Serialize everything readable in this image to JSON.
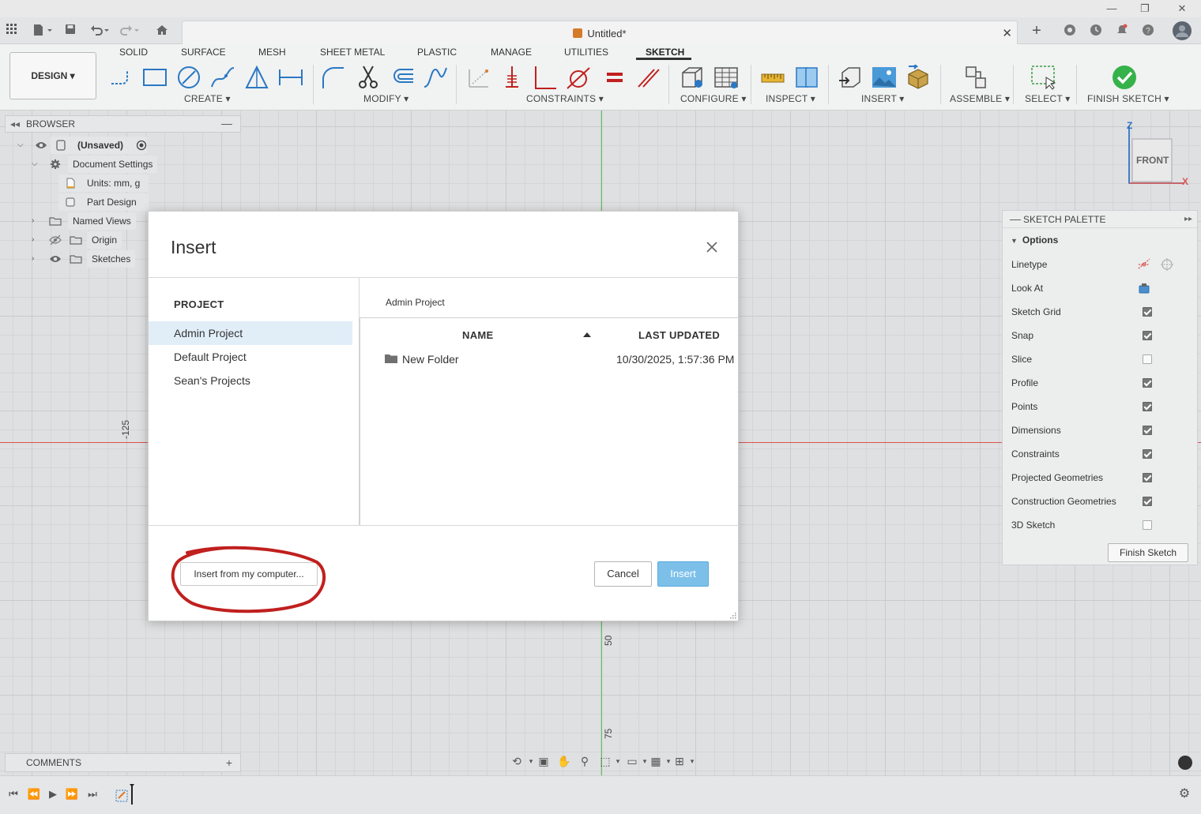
{
  "doc_tab": {
    "title": "Untitled*"
  },
  "toolbar": {
    "workspace_label": "DESIGN ▾",
    "tabs": [
      "SOLID",
      "SURFACE",
      "MESH",
      "SHEET METAL",
      "PLASTIC",
      "MANAGE",
      "UTILITIES",
      "SKETCH"
    ],
    "active_tab": "SKETCH",
    "groups": [
      "CREATE ▾",
      "MODIFY ▾",
      "CONSTRAINTS ▾",
      "CONFIGURE ▾",
      "INSPECT ▾",
      "INSERT ▾",
      "ASSEMBLE ▾",
      "SELECT ▾",
      "FINISH SKETCH ▾"
    ]
  },
  "browser": {
    "title": "BROWSER",
    "items": [
      {
        "label": "(Unsaved)",
        "icon": "component-icon"
      },
      {
        "label": "Document Settings",
        "icon": "gear-icon"
      },
      {
        "label": "Units: mm, g",
        "icon": "document-icon"
      },
      {
        "label": "Part Design",
        "icon": "part-icon"
      },
      {
        "label": "Named Views",
        "icon": "folder-icon"
      },
      {
        "label": "Origin",
        "icon": "folder-icon"
      },
      {
        "label": "Sketches",
        "icon": "folder-icon"
      }
    ]
  },
  "canvas": {
    "axis_labels": {
      "left": "-125",
      "mid": "50",
      "bottom": "75"
    },
    "viewcube": {
      "face": "FRONT",
      "z": "Z",
      "x": "X"
    }
  },
  "sketch_palette": {
    "title": "SKETCH PALETTE",
    "section": "Options",
    "rows": [
      {
        "label": "Linetype",
        "type": "icons"
      },
      {
        "label": "Look At",
        "type": "icon"
      },
      {
        "label": "Sketch Grid",
        "type": "checkbox",
        "checked": true
      },
      {
        "label": "Snap",
        "type": "checkbox",
        "checked": true
      },
      {
        "label": "Slice",
        "type": "checkbox",
        "checked": false
      },
      {
        "label": "Profile",
        "type": "checkbox",
        "checked": true
      },
      {
        "label": "Points",
        "type": "checkbox",
        "checked": true
      },
      {
        "label": "Dimensions",
        "type": "checkbox",
        "checked": true
      },
      {
        "label": "Constraints",
        "type": "checkbox",
        "checked": true
      },
      {
        "label": "Projected Geometries",
        "type": "checkbox",
        "checked": true
      },
      {
        "label": "Construction Geometries",
        "type": "checkbox",
        "checked": true
      },
      {
        "label": "3D Sketch",
        "type": "checkbox",
        "checked": false
      }
    ],
    "finish_button": "Finish Sketch"
  },
  "comments": {
    "title": "COMMENTS"
  },
  "dialog": {
    "title": "Insert",
    "project_heading": "PROJECT",
    "projects": [
      "Admin Project",
      "Default Project",
      "Sean's Projects"
    ],
    "selected_project": "Admin Project",
    "breadcrumb": "Admin Project",
    "columns": {
      "name": "NAME",
      "updated": "LAST UPDATED"
    },
    "files": [
      {
        "name": "New Folder",
        "updated": "10/30/2025, 1:57:36 PM"
      }
    ],
    "buttons": {
      "local": "Insert from my computer...",
      "cancel": "Cancel",
      "insert": "Insert"
    }
  },
  "colors": {
    "accent": "#7cc0ea",
    "annotation": "#c0201e",
    "x_axis": "#d9534f",
    "y_axis": "#59c45c"
  }
}
